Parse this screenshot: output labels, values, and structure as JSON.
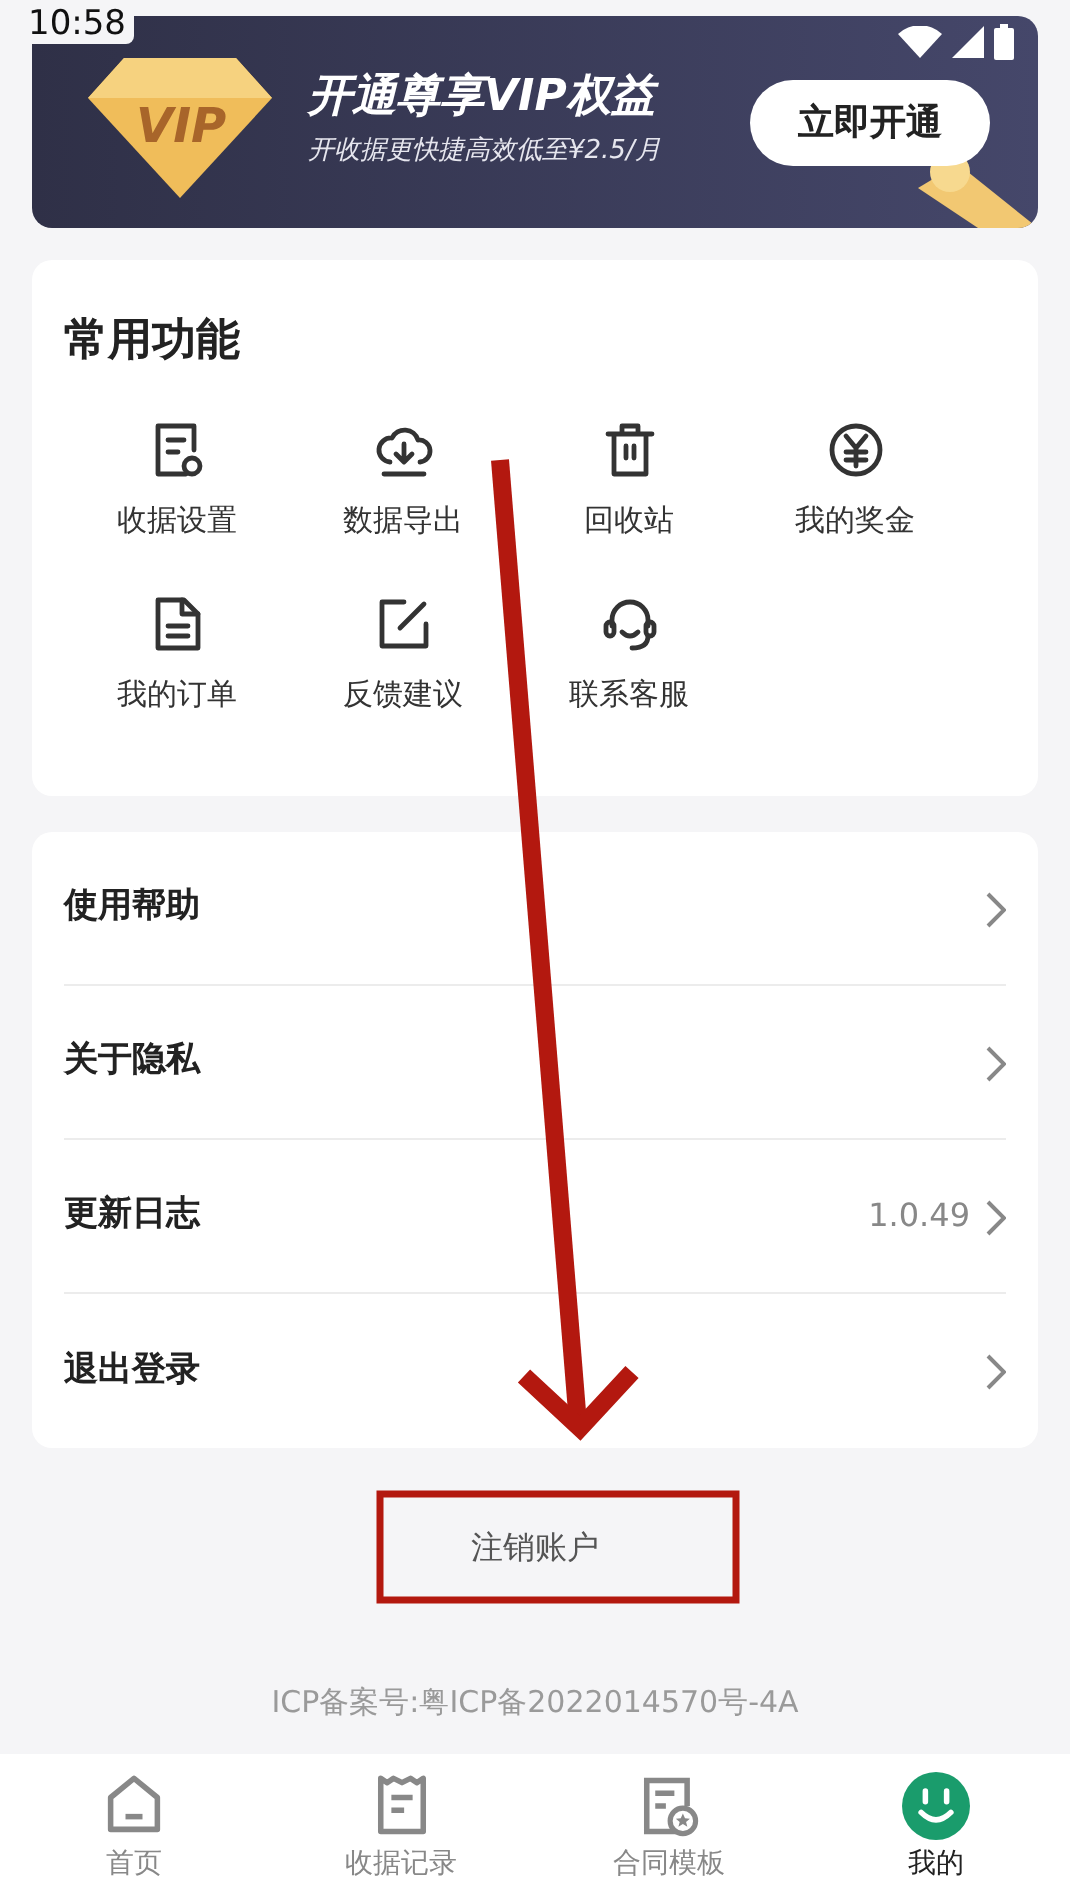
{
  "status_bar": {
    "time": "10:58"
  },
  "vip_banner": {
    "title": "开通尊享VIP权益",
    "subtitle": "开收据更快捷高效低至¥2.5/月",
    "badge": "VIP",
    "button": "立即开通"
  },
  "common_functions": {
    "title": "常用功能",
    "items": [
      {
        "label": "收据设置"
      },
      {
        "label": "数据导出"
      },
      {
        "label": "回收站"
      },
      {
        "label": "我的奖金"
      },
      {
        "label": "我的订单"
      },
      {
        "label": "反馈建议"
      },
      {
        "label": "联系客服"
      }
    ]
  },
  "menu": [
    {
      "label": "使用帮助"
    },
    {
      "label": "关于隐私"
    },
    {
      "label": "更新日志",
      "value": "1.0.49"
    },
    {
      "label": "退出登录"
    }
  ],
  "cancel_account": "注销账户",
  "icp": "ICP备案号:粤ICP备2022014570号-4A",
  "bottom_nav": [
    {
      "label": "首页",
      "selected": false
    },
    {
      "label": "收据记录",
      "selected": false
    },
    {
      "label": "合同模板",
      "selected": false
    },
    {
      "label": "我的",
      "selected": true
    }
  ]
}
